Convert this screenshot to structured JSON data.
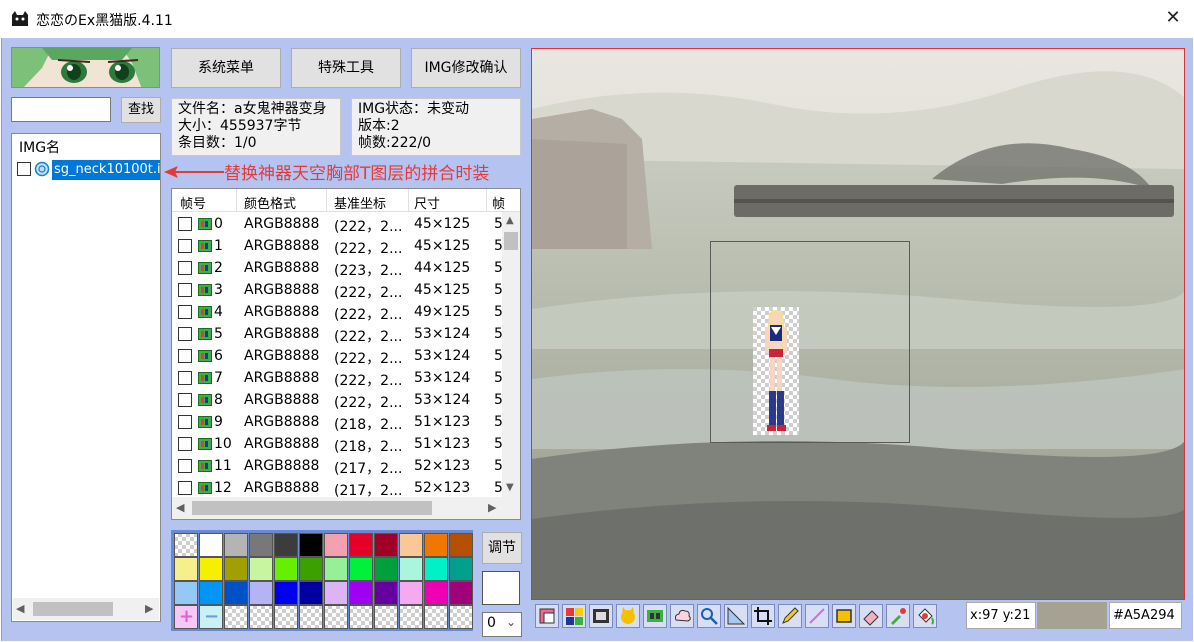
{
  "window": {
    "title": "恋恋のEx黑猫版.4.11",
    "close_glyph": "✕"
  },
  "search": {
    "value": "",
    "button_label": "查找"
  },
  "img_list": {
    "header": "IMG名",
    "items": [
      {
        "name": "sg_neck10100t.img",
        "checked": false,
        "selected": true
      }
    ]
  },
  "buttons": {
    "system_menu": "系统菜单",
    "special_tools": "特殊工具",
    "img_confirm": "IMG修改确认"
  },
  "file_info": {
    "name_line": "文件名：a女鬼神器变身",
    "size_line": "大小：455937字节",
    "entries_line": "条目数：1/0"
  },
  "img_info": {
    "state_line": "IMG状态：未变动",
    "version_line": "版本:2",
    "frames_line": "帧数:222/0"
  },
  "annotation": {
    "text": "替换神器天空胸部T图层的拼合时装"
  },
  "frame_table": {
    "columns": [
      "帧号",
      "颜色格式",
      "基准坐标",
      "尺寸",
      "帧"
    ],
    "rows": [
      {
        "index": "0",
        "format": "ARGB8888",
        "base": "(222，2...",
        "size": "45×125",
        "extra": "5"
      },
      {
        "index": "1",
        "format": "ARGB8888",
        "base": "(222，2...",
        "size": "45×125",
        "extra": "5"
      },
      {
        "index": "2",
        "format": "ARGB8888",
        "base": "(223，2...",
        "size": "44×125",
        "extra": "5"
      },
      {
        "index": "3",
        "format": "ARGB8888",
        "base": "(222，2...",
        "size": "45×125",
        "extra": "5"
      },
      {
        "index": "4",
        "format": "ARGB8888",
        "base": "(222，2...",
        "size": "49×125",
        "extra": "5"
      },
      {
        "index": "5",
        "format": "ARGB8888",
        "base": "(222，2...",
        "size": "53×124",
        "extra": "5"
      },
      {
        "index": "6",
        "format": "ARGB8888",
        "base": "(222，2...",
        "size": "53×124",
        "extra": "5"
      },
      {
        "index": "7",
        "format": "ARGB8888",
        "base": "(222，2...",
        "size": "53×124",
        "extra": "5"
      },
      {
        "index": "8",
        "format": "ARGB8888",
        "base": "(222，2...",
        "size": "53×124",
        "extra": "5"
      },
      {
        "index": "9",
        "format": "ARGB8888",
        "base": "(218，2...",
        "size": "51×123",
        "extra": "5"
      },
      {
        "index": "10",
        "format": "ARGB8888",
        "base": "(218，2...",
        "size": "51×123",
        "extra": "5"
      },
      {
        "index": "11",
        "format": "ARGB8888",
        "base": "(217，2...",
        "size": "52×123",
        "extra": "5"
      },
      {
        "index": "12",
        "format": "ARGB8888",
        "base": "(217，2...",
        "size": "52×123",
        "extra": "5"
      }
    ]
  },
  "palette": {
    "colors": [
      "transparent",
      "#ffffff",
      "#b4b4b4",
      "#787878",
      "#3c3c3c",
      "#000000",
      "#f5a0b0",
      "#e60028",
      "#a00028",
      "#fac896",
      "#f07800",
      "#b45000",
      "#f5f08c",
      "#f5f000",
      "#a0a000",
      "#c8f5a0",
      "#64f000",
      "#3ca000",
      "#96f096",
      "#00f03c",
      "#00a03c",
      "#aaf5dc",
      "#00f0c8",
      "#00a08c",
      "#96c8f5",
      "#0096f5",
      "#0050c8",
      "#b4b4f5",
      "#0000f0",
      "#0000a0",
      "#dcb4f5",
      "#a000f0",
      "#6400a0",
      "#f5aaf0",
      "#f000b4",
      "#a00078",
      "#f5c8f5",
      "#c8f0f5",
      "transparent",
      "transparent",
      "transparent",
      "transparent",
      "transparent",
      "transparent",
      "transparent",
      "transparent",
      "transparent",
      "transparent"
    ],
    "adjust_label": "调节",
    "zoom_value": "0"
  },
  "toolbar": {
    "tools": [
      "layers-icon",
      "palette-grid-icon",
      "film-icon",
      "cat-face-icon",
      "frames-icon",
      "cloud-icon",
      "magnifier-icon",
      "measure-icon",
      "crop-icon",
      "pencil-icon",
      "line-icon",
      "rectangle-icon",
      "eraser-icon",
      "eyedropper-icon",
      "fill-icon"
    ]
  },
  "status": {
    "coords": "x:97 y:21",
    "color_hex": "#A5A294",
    "sample_color": "#a5a294"
  }
}
